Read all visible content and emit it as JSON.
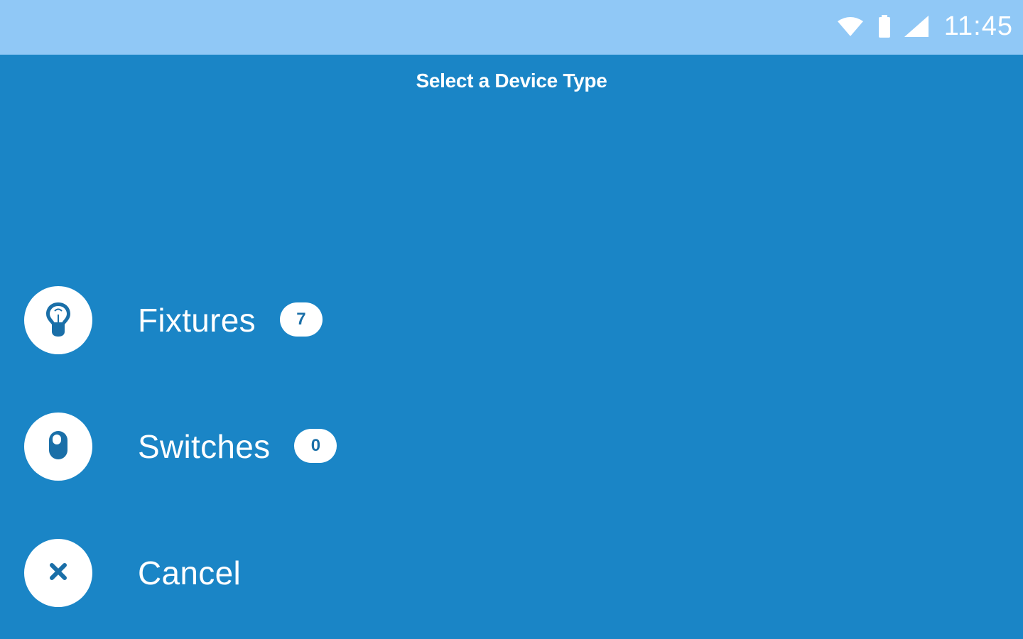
{
  "status_bar": {
    "time": "11:45",
    "icons": [
      "wifi-icon",
      "battery-icon",
      "signal-icon"
    ]
  },
  "header": {
    "title": "Select a Device Type"
  },
  "menu": {
    "items": [
      {
        "label": "Fixtures",
        "count": "7",
        "icon": "lightbulb-icon"
      },
      {
        "label": "Switches",
        "count": "0",
        "icon": "switch-icon"
      },
      {
        "label": "Cancel",
        "icon": "close-icon"
      }
    ]
  },
  "colors": {
    "background": "#1a85c6",
    "status_bar": "#90c8f6",
    "icon": "#1a6fa8",
    "text": "#ffffff"
  }
}
